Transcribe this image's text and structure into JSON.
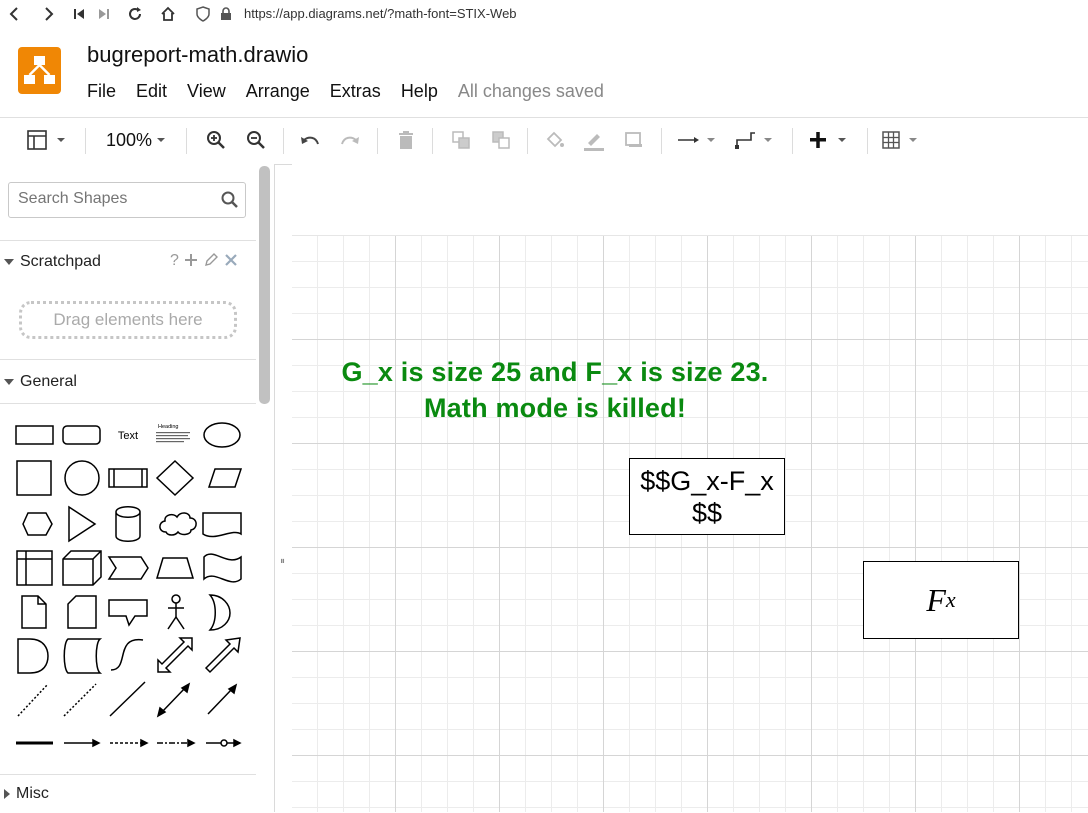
{
  "browser": {
    "url": "https://app.diagrams.net/?math-font=STIX-Web"
  },
  "app": {
    "title": "bugreport-math.drawio",
    "menu": [
      "File",
      "Edit",
      "View",
      "Arrange",
      "Extras",
      "Help"
    ],
    "status": "All changes saved",
    "accent": "#f08705"
  },
  "toolbar": {
    "zoom": "100%"
  },
  "sidebar": {
    "search_placeholder": "Search Shapes",
    "scratchpad": {
      "title": "Scratchpad",
      "help": "?",
      "drop_hint": "Drag elements here"
    },
    "general": {
      "title": "General",
      "text_shape_label": "Text",
      "heading_shape_label": "Heading"
    },
    "misc": {
      "title": "Misc"
    }
  },
  "canvas": {
    "note_line1": "G_x is size 25 and F_x is size 23.",
    "note_line2": "Math mode is killed!",
    "note_color": "#0a8a10",
    "box1_line1": "$$G_x-F_x",
    "box1_line2": "$$",
    "box2_base": "F",
    "box2_sub": "x"
  }
}
